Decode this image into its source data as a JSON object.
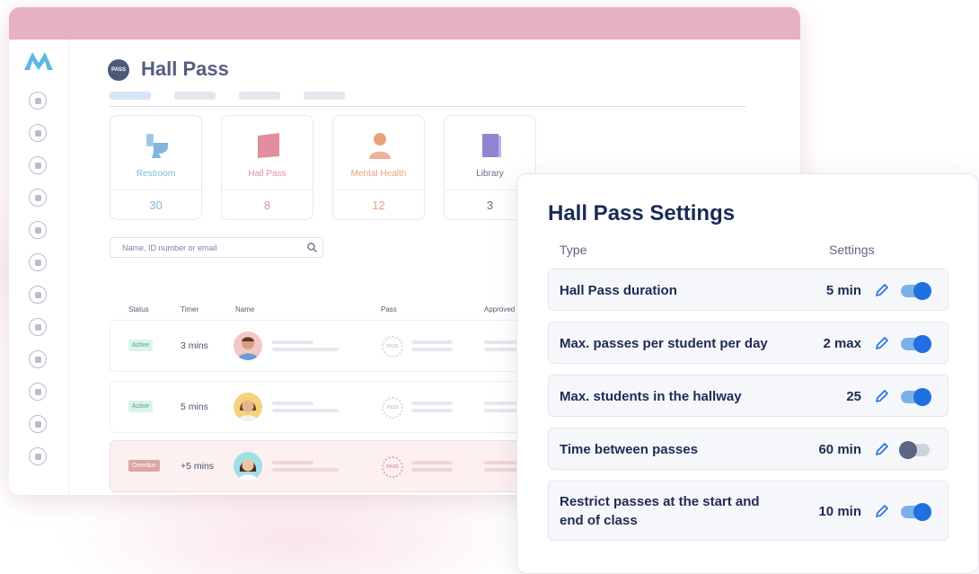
{
  "app": {
    "title": "Hall Pass",
    "badge": "PASS"
  },
  "search": {
    "placeholder": "Name, ID number or email",
    "icon": "search-icon"
  },
  "cards": [
    {
      "label": "Restroom",
      "count": "30",
      "color": "#7fb8da",
      "icon": "toilet-icon"
    },
    {
      "label": "Hall Pass",
      "count": "8",
      "color": "#e28ea0",
      "icon": "flag-icon"
    },
    {
      "label": "Mental Health",
      "count": "12",
      "color": "#e9a07e",
      "icon": "person-icon"
    },
    {
      "label": "Library",
      "count": "3",
      "color": "#8f86cf",
      "icon": "book-icon"
    }
  ],
  "table": {
    "headers": [
      "Status",
      "Timer",
      "Name",
      "Pass",
      "Approved"
    ],
    "rows": [
      {
        "status": "Active",
        "timer": "3 mins",
        "stamp": "PASS"
      },
      {
        "status": "Active",
        "timer": "5 mins",
        "stamp": "PASS"
      },
      {
        "status": "Overdue",
        "timer": "+5 mins",
        "stamp": "PASS"
      }
    ]
  },
  "settings": {
    "title": "Hall Pass Settings",
    "col_type": "Type",
    "col_settings": "Settings",
    "items": [
      {
        "label": "Hall Pass duration",
        "value": "5 min",
        "enabled": true
      },
      {
        "label": "Max. passes per student per day",
        "value": "2 max",
        "enabled": true
      },
      {
        "label": "Max. students in the hallway",
        "value": "25",
        "enabled": true
      },
      {
        "label": "Time between passes",
        "value": "60 min",
        "enabled": false
      },
      {
        "label_line1": "Restrict passes at the start and",
        "label_line2": "end of class",
        "value": "10 min",
        "enabled": true
      }
    ]
  },
  "colors": {
    "window_bar": "#e7b1c1",
    "accent": "#1f6fe0",
    "title": "#1a2a55"
  }
}
